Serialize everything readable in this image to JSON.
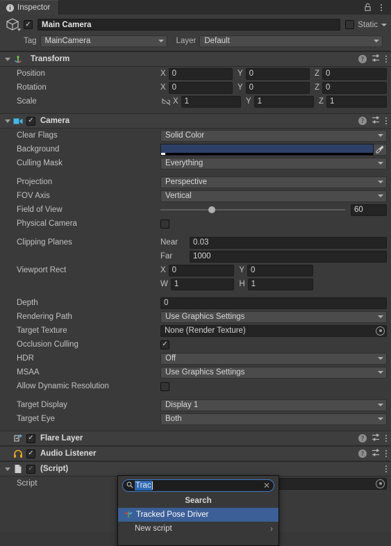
{
  "window": {
    "tab_label": "Inspector",
    "tab_icon": "info-icon",
    "lock_icon": "lock-icon",
    "menu_icon": "kebab-menu-icon"
  },
  "gameobject": {
    "icon": "cube-icon",
    "enabled_check": "✓",
    "name": "Main Camera",
    "static_label": "Static",
    "static_checked": false,
    "tag_label": "Tag",
    "tag_value": "MainCamera",
    "layer_label": "Layer",
    "layer_value": "Default"
  },
  "components": [
    {
      "title": "Transform",
      "icon": "transform-axis-icon",
      "has_checkbox": false,
      "rows": [
        {
          "label": "Position",
          "type": "vector3",
          "link": false,
          "values": [
            {
              "axis": "X",
              "value": "0"
            },
            {
              "axis": "Y",
              "value": "0"
            },
            {
              "axis": "Z",
              "value": "0"
            }
          ]
        },
        {
          "label": "Rotation",
          "type": "vector3",
          "link": false,
          "values": [
            {
              "axis": "X",
              "value": "0"
            },
            {
              "axis": "Y",
              "value": "0"
            },
            {
              "axis": "Z",
              "value": "0"
            }
          ]
        },
        {
          "label": "Scale",
          "type": "vector3",
          "link": true,
          "link_icon": "link-broken-icon",
          "values": [
            {
              "axis": "X",
              "value": "1"
            },
            {
              "axis": "Y",
              "value": "1"
            },
            {
              "axis": "Z",
              "value": "1"
            }
          ]
        }
      ]
    },
    {
      "title": "Camera",
      "icon": "camera-icon",
      "has_checkbox": true,
      "checked": true,
      "rows": [
        {
          "label": "Clear Flags",
          "type": "dropdown",
          "value": "Solid Color"
        },
        {
          "label": "Background",
          "type": "color",
          "color": "#2d4168",
          "alpha_pct": 2,
          "eyedropper": "eyedropper-icon"
        },
        {
          "label": "Culling Mask",
          "type": "dropdown",
          "value": "Everything"
        },
        {
          "type": "spacer"
        },
        {
          "label": "Projection",
          "type": "dropdown",
          "value": "Perspective"
        },
        {
          "label": "FOV Axis",
          "type": "dropdown",
          "value": "Vertical"
        },
        {
          "label": "Field of View",
          "type": "slider",
          "value": "60",
          "knob_pct": 28
        },
        {
          "label": "Physical Camera",
          "type": "checkbox",
          "checked": false
        },
        {
          "type": "spacer"
        },
        {
          "label": "Clipping Planes",
          "type": "sublabeled",
          "sub_label": "Near",
          "value": "0.03"
        },
        {
          "label": "",
          "type": "sublabeled",
          "sub_label": "Far",
          "value": "1000"
        },
        {
          "label": "Viewport Rect",
          "type": "pair",
          "a_label": "X",
          "a_value": "0",
          "b_label": "Y",
          "b_value": "0"
        },
        {
          "label": "",
          "type": "pair",
          "a_label": "W",
          "a_value": "1",
          "b_label": "H",
          "b_value": "1"
        },
        {
          "type": "spacer"
        },
        {
          "label": "Depth",
          "type": "text",
          "value": "0"
        },
        {
          "label": "Rendering Path",
          "type": "dropdown",
          "value": "Use Graphics Settings"
        },
        {
          "label": "Target Texture",
          "type": "object",
          "value": "None (Render Texture)",
          "picker": "object-picker-icon"
        },
        {
          "label": "Occlusion Culling",
          "type": "checkbox",
          "checked": true
        },
        {
          "label": "HDR",
          "type": "dropdown",
          "value": "Off"
        },
        {
          "label": "MSAA",
          "type": "dropdown",
          "value": "Use Graphics Settings"
        },
        {
          "label": "Allow Dynamic Resolution",
          "type": "checkbox",
          "checked": false
        },
        {
          "type": "spacer"
        },
        {
          "label": "Target Display",
          "type": "dropdown",
          "value": "Display 1"
        },
        {
          "label": "Target Eye",
          "type": "dropdown",
          "value": "Both"
        }
      ]
    },
    {
      "title": "Flare Layer",
      "icon": "flare-layer-icon",
      "has_checkbox": true,
      "checked": true,
      "collapsed": true,
      "rows": []
    },
    {
      "title": "Audio Listener",
      "icon": "headphones-icon",
      "has_checkbox": true,
      "checked": true,
      "collapsed": true,
      "rows": []
    },
    {
      "title": "(Script)",
      "icon": "script-file-icon",
      "has_checkbox": true,
      "checked": true,
      "checkbox_dimmed": true,
      "rows": [
        {
          "label": "Script",
          "type": "object",
          "value": "",
          "picker": "object-picker-icon"
        }
      ]
    }
  ],
  "component_header_icons": {
    "help": "help-icon",
    "preset": "preset-settings-icon",
    "menu": "kebab-menu-icon"
  },
  "script_popup": {
    "search_icon": "search-icon",
    "search_value": "Trac",
    "search_placeholder": "Search",
    "clear_icon": "clear-x-icon",
    "header": "Search",
    "items": [
      {
        "label": "Tracked Pose Driver",
        "selected": true,
        "icon": "script-asset-icon",
        "has_submenu": false
      },
      {
        "label": "New script",
        "selected": false,
        "icon": "",
        "has_submenu": true,
        "chevron": "chevron-right-icon"
      }
    ]
  }
}
